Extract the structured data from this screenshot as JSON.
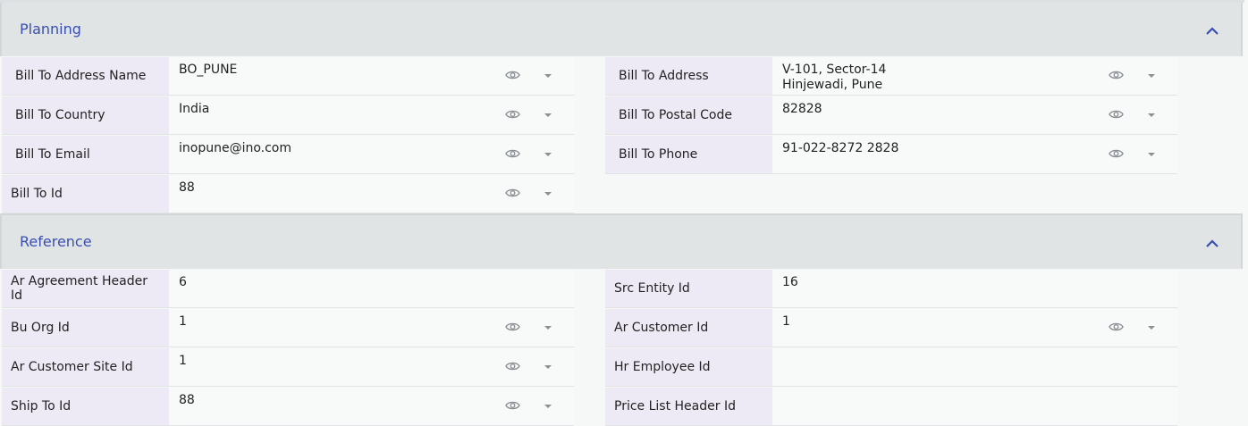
{
  "sections": [
    {
      "title": "Planning",
      "icon": "chevron-up-icon",
      "fields": [
        {
          "label": "Bill To Address Name",
          "value": "BO_PUNE",
          "controls": true
        },
        {
          "label": "Bill To Address",
          "value": "V-101, Sector-14\nHinjewadi, Pune",
          "controls": true
        },
        {
          "label": "Bill To Country",
          "value": "India",
          "controls": true
        },
        {
          "label": "Bill To Postal Code",
          "value": "82828",
          "controls": true
        },
        {
          "label": "Bill To Email",
          "value": "inopune@ino.com",
          "controls": true
        },
        {
          "label": "Bill To Phone",
          "value": "91-022-8272 2828",
          "controls": true
        },
        {
          "label": "Bill To Id",
          "value": "88",
          "controls": true
        }
      ]
    },
    {
      "title": "Reference",
      "icon": "chevron-up-icon",
      "fields": [
        {
          "label": "Ar Agreement Header Id",
          "value": "6",
          "controls": false
        },
        {
          "label": "Src Entity Id",
          "value": "16",
          "controls": false
        },
        {
          "label": "Bu Org Id",
          "value": "1",
          "controls": true
        },
        {
          "label": "Ar Customer Id",
          "value": "1",
          "controls": true
        },
        {
          "label": "Ar Customer Site Id",
          "value": "1",
          "controls": true
        },
        {
          "label": "Hr Employee Id",
          "value": "",
          "controls": false
        },
        {
          "label": "Ship To Id",
          "value": "88",
          "controls": true
        },
        {
          "label": "Price List Header Id",
          "value": "",
          "controls": false
        }
      ]
    }
  ],
  "colors": {
    "header_bg": "#e0e4e4",
    "title": "#3b4fb0",
    "label_bg": "#eeeaf5",
    "icon": "#8a8f94"
  }
}
